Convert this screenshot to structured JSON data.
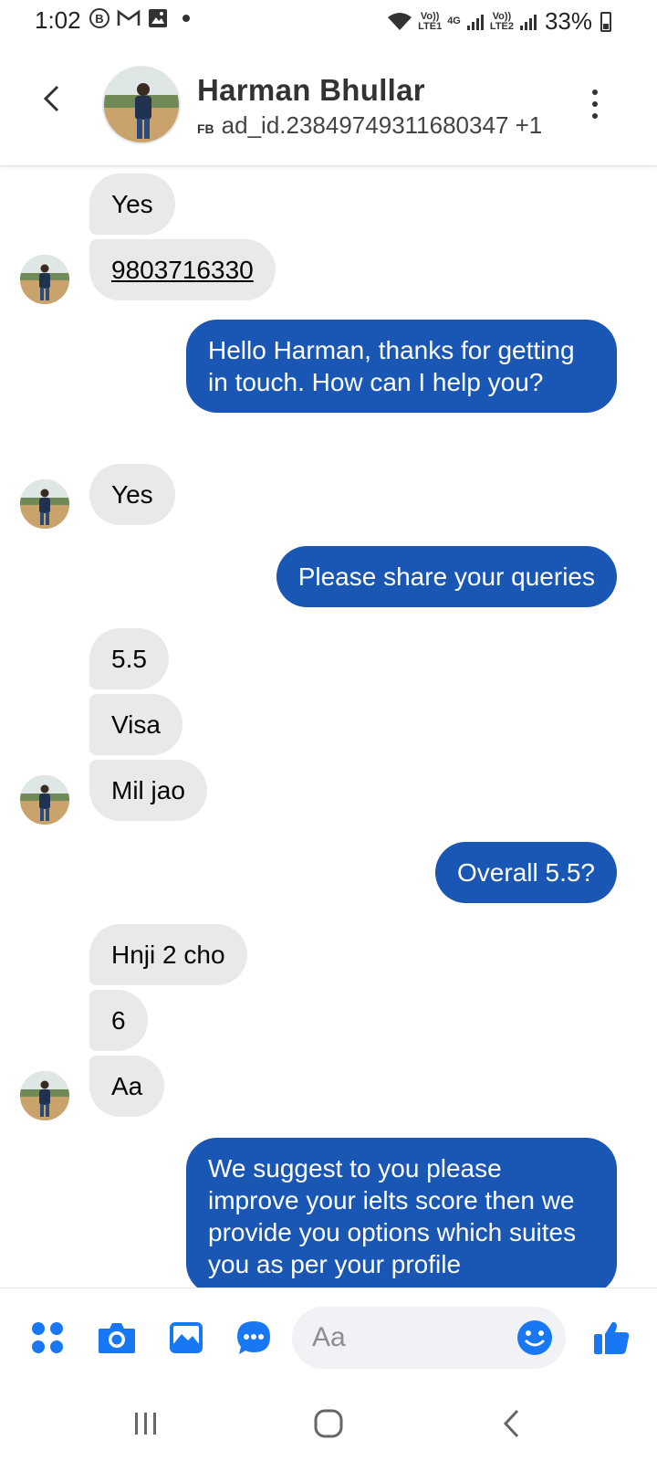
{
  "status_bar": {
    "time": "1:02",
    "left_icons": [
      "b-icon",
      "gmail-icon",
      "gallery-icon",
      "dot-icon"
    ],
    "sim1_label_top": "Vo))",
    "sim1_label_bottom": "LTE1",
    "network_label": "4G",
    "sim2_label_top": "Vo))",
    "sim2_label_bottom": "LTE2",
    "battery": "33%"
  },
  "header": {
    "contact_name": "Harman Bhullar",
    "source_tag": "FB",
    "subtitle": "ad_id.23849749311680347 +1"
  },
  "messages": [
    {
      "dir": "in",
      "text": "Yes"
    },
    {
      "dir": "in",
      "text": "9803716330",
      "link": true
    },
    {
      "dir": "out",
      "text": "Hello Harman, thanks for getting in touch. How can I help you?"
    },
    {
      "dir": "in",
      "text": "Yes"
    },
    {
      "dir": "out",
      "text": "Please share your queries"
    },
    {
      "dir": "in",
      "text": "5.5"
    },
    {
      "dir": "in",
      "text": "Visa"
    },
    {
      "dir": "in",
      "text": "Mil jao"
    },
    {
      "dir": "out",
      "text": "Overall 5.5?"
    },
    {
      "dir": "in",
      "text": "Hnji 2 cho"
    },
    {
      "dir": "in",
      "text": "6"
    },
    {
      "dir": "in",
      "text": "Aa"
    },
    {
      "dir": "out",
      "text": "We suggest to you please improve your ielts score then we provide you options which suites you as per your profile"
    }
  ],
  "composer": {
    "placeholder": "Aa",
    "icons": [
      "apps-icon",
      "camera-icon",
      "gallery-icon",
      "messenger-more-icon",
      "emoji-icon",
      "like-icon"
    ]
  },
  "colors": {
    "accent": "#1877f2",
    "outgoing_bubble": "#1a56b3",
    "incoming_bubble": "#e9e9eb"
  }
}
